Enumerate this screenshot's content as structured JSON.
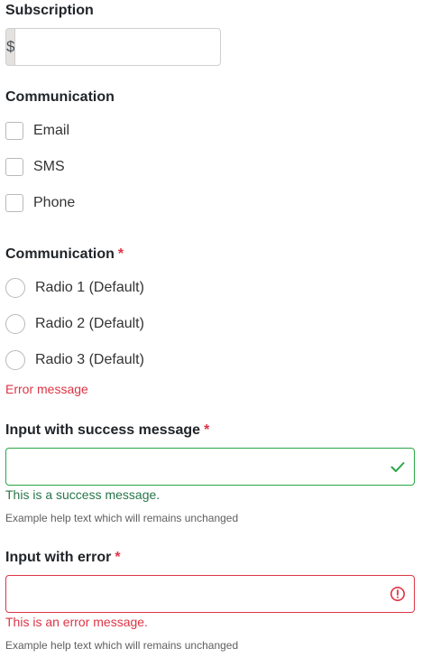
{
  "subscription": {
    "label": "Subscription",
    "prefix": "$",
    "value": ""
  },
  "communication_checkboxes": {
    "label": "Communication",
    "options": [
      {
        "label": "Email",
        "checked": false
      },
      {
        "label": "SMS",
        "checked": false
      },
      {
        "label": "Phone",
        "checked": false
      }
    ]
  },
  "communication_radios": {
    "label": "Communication",
    "required_mark": "*",
    "options": [
      {
        "label": "Radio 1 (Default)",
        "selected": false
      },
      {
        "label": "Radio 2 (Default)",
        "selected": false
      },
      {
        "label": "Radio 3 (Default)",
        "selected": false
      }
    ],
    "error": "Error message"
  },
  "success_input": {
    "label": "Input with success message",
    "required_mark": "*",
    "value": "",
    "message": "This is a success message.",
    "help": "Example help text which will remains unchanged",
    "icon": "check-icon"
  },
  "error_input": {
    "label": "Input with error",
    "required_mark": "*",
    "value": "",
    "message": "This is an error message.",
    "help": "Example help text which will remains unchanged",
    "icon": "error-circle-icon"
  },
  "colors": {
    "error": "#dc3545",
    "success_border": "#28a745",
    "success_text": "#28754a",
    "prefix_bg": "#e4e2df"
  }
}
